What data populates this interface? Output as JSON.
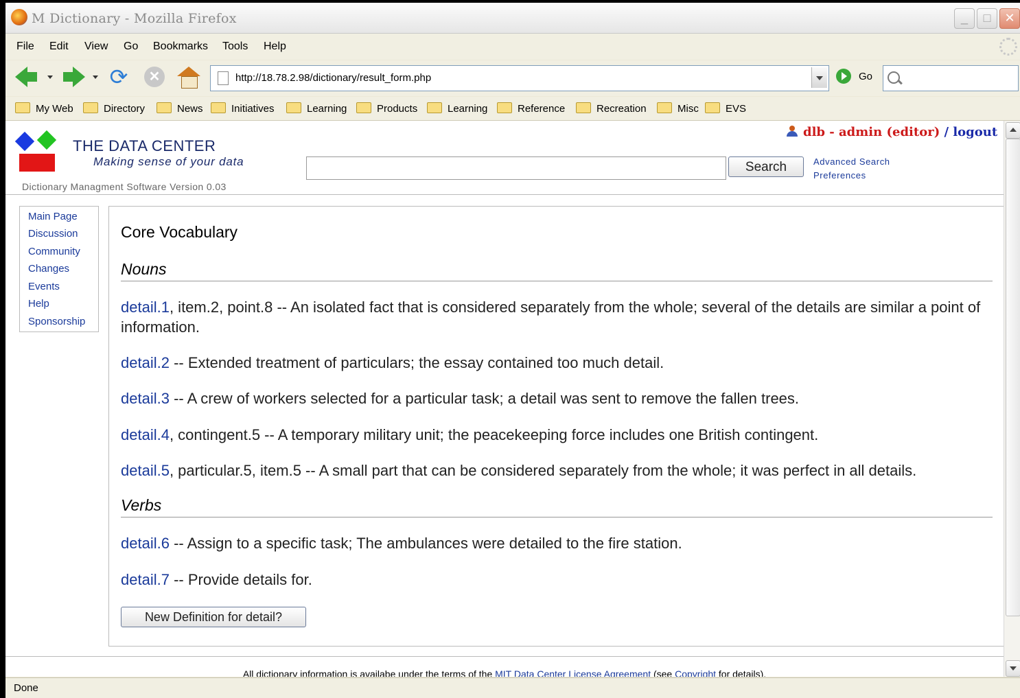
{
  "window": {
    "title": "M Dictionary - Mozilla Firefox",
    "minimize": "_",
    "maximize": "□",
    "close": "✕"
  },
  "menu": [
    "File",
    "Edit",
    "View",
    "Go",
    "Bookmarks",
    "Tools",
    "Help"
  ],
  "nav": {
    "url": "http://18.78.2.98/dictionary/result_form.php",
    "go_label": "Go",
    "reload_glyph": "⟳",
    "stop_glyph": "✕",
    "search_value": ""
  },
  "bookmarks": [
    "My Web",
    "Directory",
    "News",
    "Initiatives",
    "Learning",
    "Products",
    "Learning",
    "Reference",
    "Recreation",
    "Misc",
    "EVS"
  ],
  "site": {
    "title": "THE DATA CENTER",
    "tagline": "Making sense of your data",
    "version": "Dictionary Managment Software Version 0.03",
    "search_value": "",
    "search_button": "Search",
    "advanced_search": "Advanced Search",
    "preferences": "Preferences",
    "user": {
      "text": "dlb - admin (editor)",
      "separator": " / ",
      "logout": "logout"
    }
  },
  "sidebar": [
    "Main Page",
    "Discussion",
    "Community",
    "Changes",
    "Events",
    "Help",
    "Sponsorship"
  ],
  "main": {
    "heading": "Core Vocabulary",
    "nouns_heading": "Nouns",
    "verbs_heading": "Verbs",
    "nouns": [
      {
        "link": "detail.1",
        "text": ", item.2, point.8 -- An isolated fact that is considered separately from the whole; several of the details are similar a point of information."
      },
      {
        "link": "detail.2",
        "text": " -- Extended treatment of particulars; the essay contained too much detail."
      },
      {
        "link": "detail.3",
        "text": " -- A crew of workers selected for a particular task; a detail was sent to remove the fallen trees."
      },
      {
        "link": "detail.4",
        "text": ", contingent.5 -- A temporary military unit; the peacekeeping force includes one British contingent."
      },
      {
        "link": "detail.5",
        "text": ", particular.5, item.5 -- A small part that can be considered separately from the whole; it was perfect in all details."
      }
    ],
    "verbs": [
      {
        "link": "detail.6",
        "text": " -- Assign to a specific task; The ambulances were detailed to the fire station."
      },
      {
        "link": "detail.7",
        "text": " -- Provide details for."
      }
    ],
    "new_definition_button": "New Definition for detail?"
  },
  "footer": {
    "prefix": "All dictionary information is availabe under the terms of the ",
    "license_link": "MIT Data Center License Agreement",
    "middle": " (see ",
    "copyright_link": "Copyright",
    "suffix": " for details)."
  },
  "status": "Done"
}
